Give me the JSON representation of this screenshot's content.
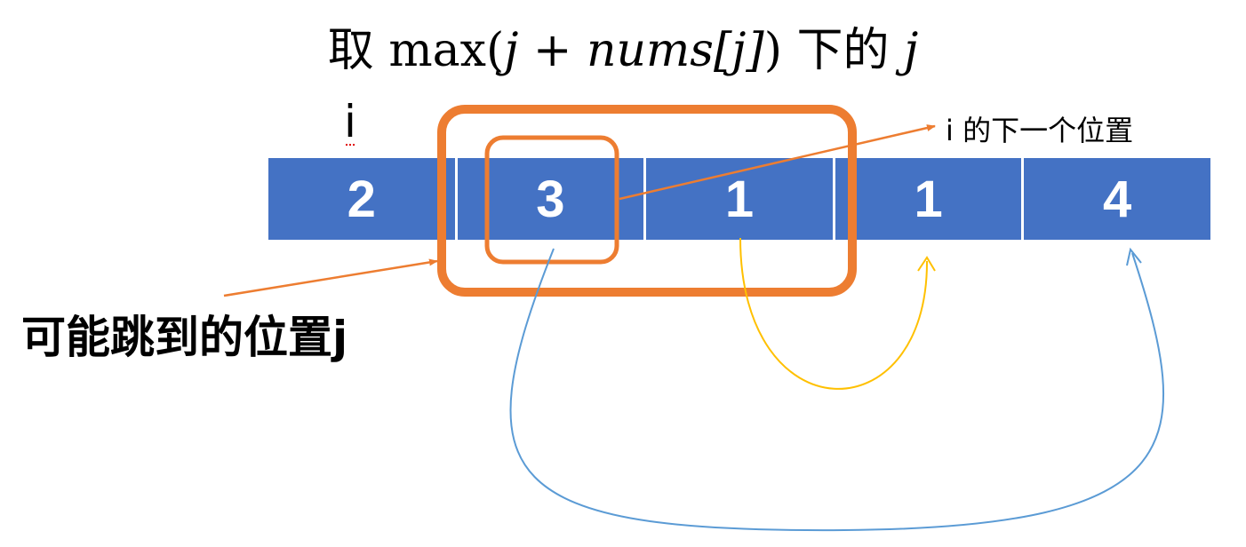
{
  "title": {
    "prefix": "取 max(",
    "expr": "j + nums[j]",
    "close": ")",
    "suffix": "下的",
    "var": "j"
  },
  "i_label": "i",
  "next_label": "i 的下一个位置",
  "pos_label": "可能跳到的位置j",
  "cells": [
    "2",
    "3",
    "1",
    "1",
    "4"
  ],
  "colors": {
    "cell_fill": "#4472c4",
    "highlight": "#ed7d31",
    "yellow_arrow": "#ffc000",
    "blue_arrow": "#5b9bd5"
  }
}
